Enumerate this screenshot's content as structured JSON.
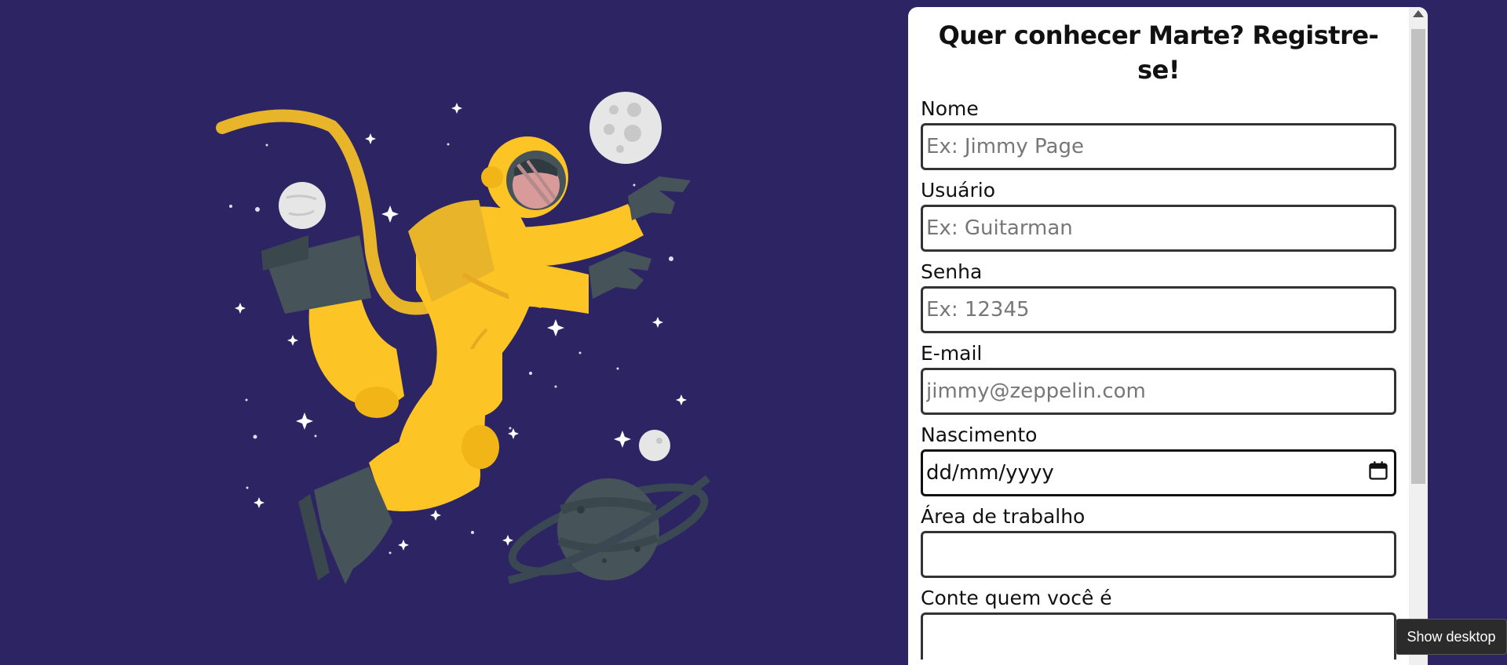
{
  "form": {
    "title": "Quer conhecer Marte? Registre-se!",
    "fields": [
      {
        "label": "Nome",
        "placeholder": "Ex: Jimmy Page"
      },
      {
        "label": "Usuário",
        "placeholder": "Ex: Guitarman"
      },
      {
        "label": "Senha",
        "placeholder": "Ex: 12345"
      },
      {
        "label": "E-mail",
        "placeholder": "jimmy@zeppelin.com"
      },
      {
        "label": "Nascimento",
        "value": "dd/mm/yyyy"
      },
      {
        "label": "Área de trabalho",
        "placeholder": ""
      },
      {
        "label": "Conte quem você é"
      }
    ]
  },
  "tooltip": {
    "text": "Show desktop"
  },
  "colors": {
    "background": "#2d2563",
    "suit": "#fcc425",
    "boots": "#46545a",
    "panel": "#ffffff"
  },
  "icons": [
    "calendar-icon",
    "scroll-up-arrow-icon"
  ]
}
